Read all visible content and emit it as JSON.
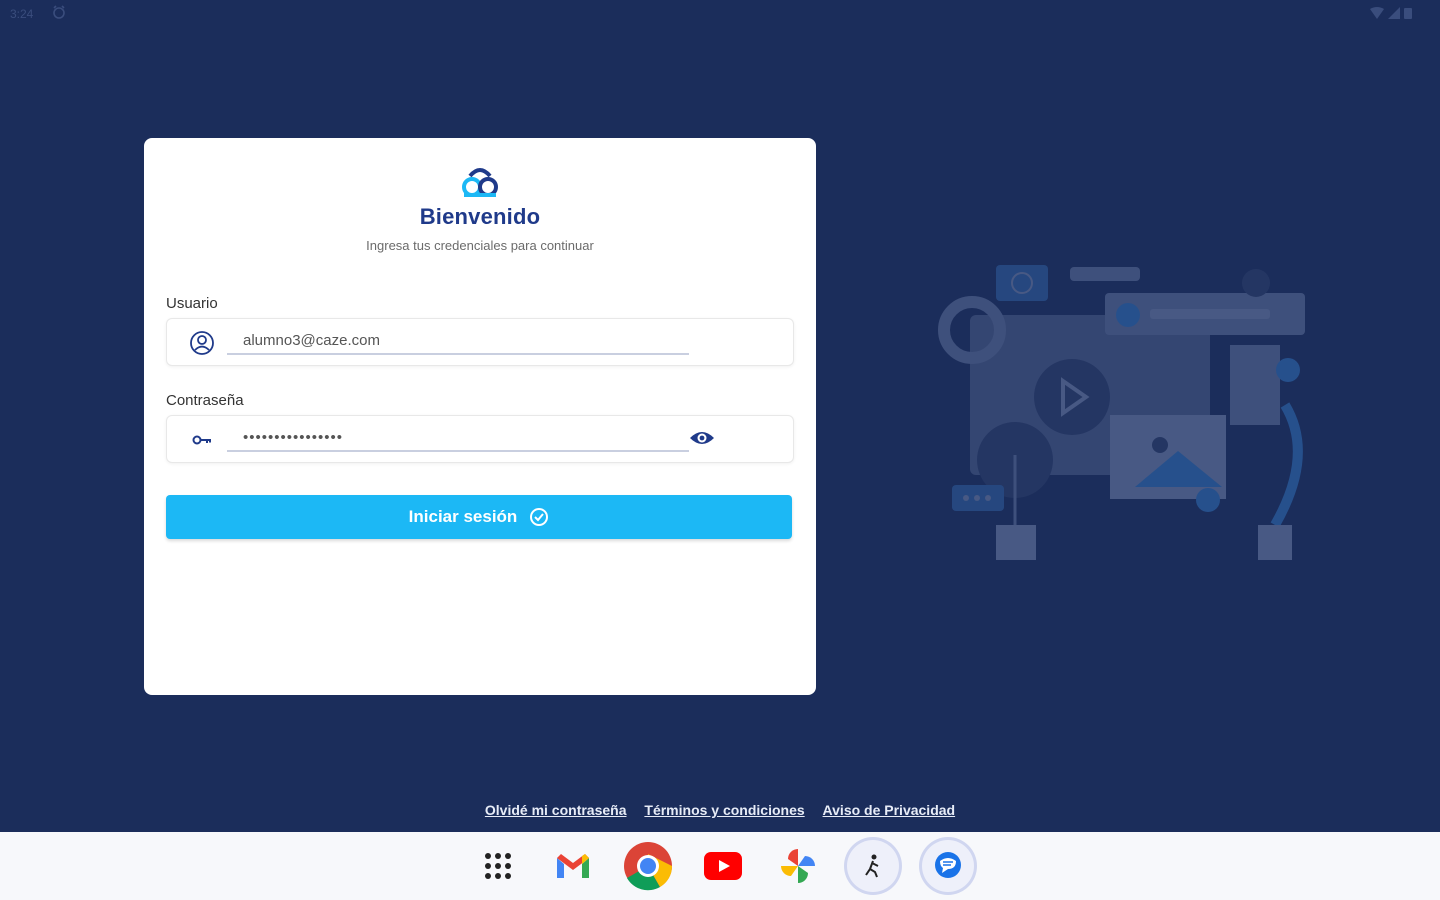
{
  "status_bar": {
    "time": "3:24"
  },
  "login": {
    "title": "Bienvenido",
    "subtitle": "Ingresa tus credenciales para continuar",
    "username_label": "Usuario",
    "username_value": "alumno3@caze.com",
    "password_label": "Contraseña",
    "password_value": "••••••••••••••••",
    "submit_label": "Iniciar sesión"
  },
  "footer": {
    "forgot_password": "Olvidé mi contraseña",
    "terms": "Términos y condiciones",
    "privacy": "Aviso de Privacidad"
  },
  "taskbar": {
    "apps": [
      "app-launcher",
      "gmail",
      "chrome",
      "youtube",
      "photos",
      "app-shortcut",
      "messages"
    ]
  },
  "colors": {
    "background": "#1b2d5b",
    "accent": "#1cb8f5",
    "title": "#1f3a8a"
  }
}
